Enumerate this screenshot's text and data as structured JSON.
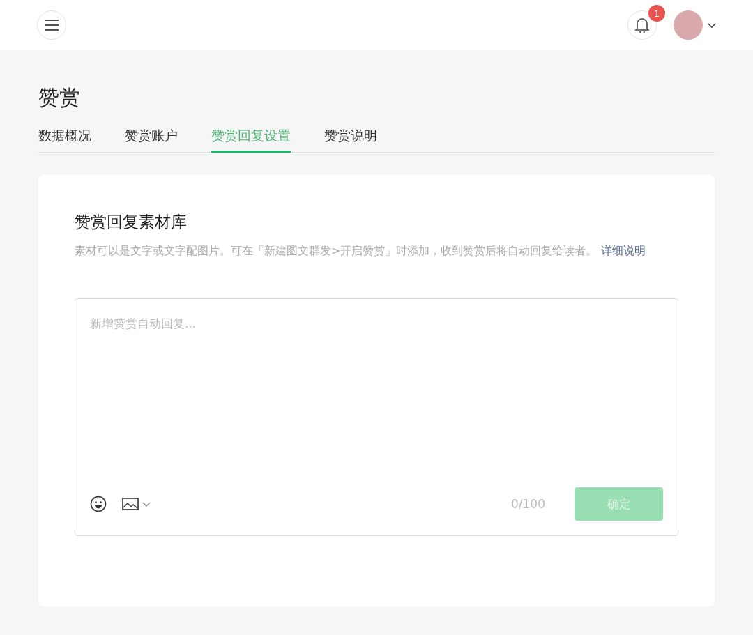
{
  "header": {
    "notification_count": "1"
  },
  "page_title": "赞赏",
  "tabs": [
    {
      "label": "数据概况",
      "selected": false
    },
    {
      "label": "赞赏账户",
      "selected": false
    },
    {
      "label": "赞赏回复设置",
      "selected": true
    },
    {
      "label": "赞赏说明",
      "selected": false
    }
  ],
  "card": {
    "title": "赞赏回复素材库",
    "description": "素材可以是文字或文字配图片。可在「新建图文群发>开启赞赏」时添加，收到赞赏后将自动回复给读者。",
    "link": "详细说明",
    "editor": {
      "placeholder": "新增赞赏自动回复...",
      "counter": "0/100",
      "confirm_button": {
        "label": "确定",
        "disabled": true
      }
    }
  }
}
